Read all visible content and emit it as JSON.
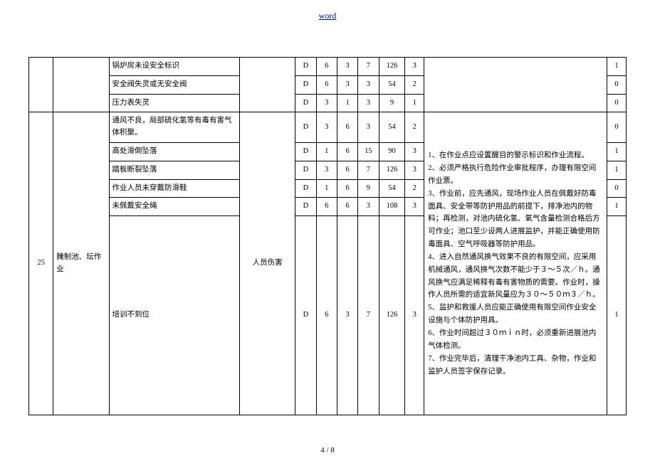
{
  "header": {
    "link_text": "word"
  },
  "footer": {
    "page": "4 / 8"
  },
  "section1": {
    "rows": [
      {
        "desc": "锅炉房未设安全标识",
        "d": "D",
        "n1": "6",
        "n2": "3",
        "n3": "7",
        "n4": "126",
        "n5": "3",
        "last": "1"
      },
      {
        "desc": "安全阀失灵或无安全阀",
        "d": "D",
        "n1": "6",
        "n2": "3",
        "n3": "3",
        "n4": "54",
        "n5": "2",
        "last": "0"
      },
      {
        "desc": "压力表失灵",
        "d": "D",
        "n1": "3",
        "n2": "1",
        "n3": "3",
        "n4": "9",
        "n5": "1",
        "last": "0"
      }
    ]
  },
  "section2": {
    "seq": "25",
    "item": "腌制池、坛作业",
    "cause": "人员伤害",
    "rows": [
      {
        "desc": "通风不良，局部硫化氢等有毒有害气体积聚。",
        "d": "D",
        "n1": "3",
        "n2": "6",
        "n3": "3",
        "n4": "54",
        "n5": "2",
        "last": "0"
      },
      {
        "desc": "高处滑倒坠落",
        "d": "D",
        "n1": "1",
        "n2": "6",
        "n3": "15",
        "n4": "90",
        "n5": "3",
        "last": "1"
      },
      {
        "desc": "踏板断裂坠落",
        "d": "D",
        "n1": "3",
        "n2": "6",
        "n3": "7",
        "n4": "126",
        "n5": "3",
        "last": "1"
      },
      {
        "desc": "作业人员未穿戴防滑鞋",
        "d": "D",
        "n1": "1",
        "n2": "6",
        "n3": "9",
        "n4": "54",
        "n5": "2",
        "last": "0"
      },
      {
        "desc": "未佩戴安全绳",
        "d": "D",
        "n1": "6",
        "n2": "6",
        "n3": "3",
        "n4": "108",
        "n5": "3",
        "last": "1"
      },
      {
        "desc": "培训不到位",
        "d": "D",
        "n1": "6",
        "n2": "3",
        "n3": "7",
        "n4": "126",
        "n5": "3",
        "last": "1"
      }
    ],
    "measure": "1、在作业点应设置醒目的警示标识和作业流程。\n2、必须严格执行危险作业审批程序，办理有限空间作业票。\n3、作业前，应先通风，现场作业人员在佩戴好防毒面具、安全带等防护用品的前提下，排净池内的物料；再检测，对池内硫化氢、氧气含量检测合格后方可作业；池口至少设两人进展监护，并能正确使用防毒面具、空气呼吸器等防护用品。\n4、进入自然通风换气效果不良的有限空间，应采用机械通风，通风换气次数不能少于３～５次／ｈ。通风换气应满足稀释有毒有害物质的需要。作业时，操作人员所需的适宜新风量应为３０～５０ｍ３／ｈ。\n5、监护和救援人员应能正确使用有限空间作业安全设施与个体防护用具。\n6、作业时间超过３０ｍｉｎ时，必须重新进展池内气体检测。\n7、作业完毕后，清理干净池内工具、杂物，作业和监护人员签字保存记录。"
  }
}
